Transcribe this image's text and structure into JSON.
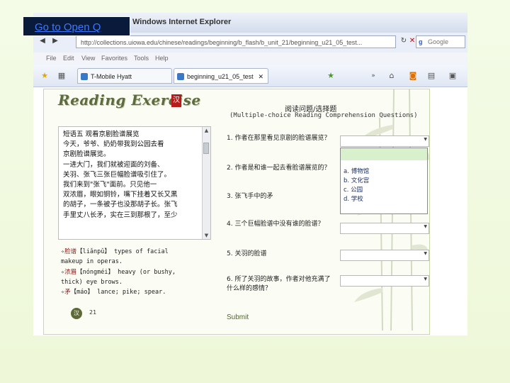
{
  "overlay": {
    "goto_label": "Go to Open Q"
  },
  "browser": {
    "title": "Windows Internet Explorer",
    "address": "http://collections.uiowa.edu/chinese/readings/beginning/b_flash/b_unit_21/beginning_u21_05_test...",
    "search_placeholder": "Google",
    "menu": [
      "File",
      "Edit",
      "View",
      "Favorites",
      "Tools",
      "Help"
    ],
    "tabs": [
      {
        "label": "T-Mobile Hyatt"
      },
      {
        "label": "beginning_u21_05_test"
      }
    ],
    "chevron": "»"
  },
  "page": {
    "heading": "Reading Exercise",
    "stamp": "汉",
    "question_title": "阅读问题/选择题",
    "question_subtitle": "(Multiple-choice Reading Comprehension Questions)",
    "passage_lines": [
      "短语五      观看京剧脸谱展览",
      "    今天，爷爷、奶奶带我到公园去看",
      "京剧脸谱展览。",
      "    一进大门，我们就被迎面的刘备、",
      "关羽、张飞三张巨幅脸谱吸引住了。",
      "    我们来到\"张飞\"面前。只见他一",
      "双浓眉，眼如铜铃，嘴下挂着又长又黑",
      "的胡子，一条被子也没那胡子长。张飞",
      "手里丈八长矛，实在三到那根了，至少"
    ],
    "vocab_lines": [
      {
        "bullet": "✧",
        "hz": "脸谱",
        "rest": "【liǎnpǔ】 types of facial"
      },
      {
        "bullet": "",
        "hz": "",
        "rest": "makeup in operas."
      },
      {
        "bullet": "✧",
        "hz": "浓眉",
        "rest": "【nóngméi】 heavy (or bushy,"
      },
      {
        "bullet": "",
        "hz": "",
        "rest": "thick) eye brows."
      },
      {
        "bullet": "✧",
        "hz": "矛",
        "rest": "【máo】 lance; pike; spear."
      }
    ],
    "page_icon": "汉",
    "page_number": "21",
    "questions": [
      "1. 作者在那里看见京剧的脸谱展览？",
      "2. 作者是和谁一起去看脸谱展览的？",
      "3. 张飞手中的矛",
      "4. 三个巨幅脸谱中没有谁的脸谱？",
      "5. 关羽的脸谱",
      "6. 所了关羽的故事，作者对他充满了什么样的感情？"
    ],
    "dropdown_options": [
      "a. 博物馆",
      "b. 文化宫",
      "c. 公园",
      "d. 学校"
    ],
    "submit_label": "Submit"
  }
}
